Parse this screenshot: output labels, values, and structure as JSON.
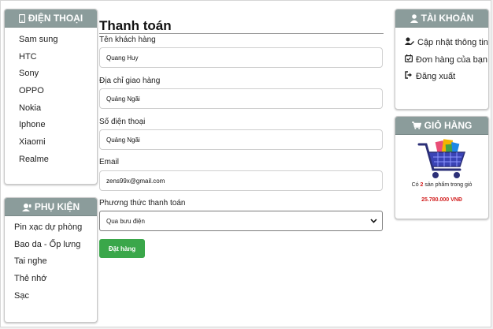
{
  "sidebar_left": {
    "phones": {
      "title": "ĐIỆN THOẠI",
      "icon": "mobile-phone-icon",
      "items": [
        "Sam sung",
        "HTC",
        "Sony",
        "OPPO",
        "Nokia",
        "Iphone",
        "Xiaomi",
        "Realme"
      ]
    },
    "accessories": {
      "title": "PHỤ KIỆN",
      "icon": "headset-user-icon",
      "items": [
        "Pin xạc dự phòng",
        "Bao da - Ốp lưng",
        "Tai nghe",
        "Thẻ nhớ",
        "Sạc"
      ]
    }
  },
  "checkout": {
    "title": "Thanh toán",
    "name_label": "Tên khách hàng",
    "name_value": "Quang Huy",
    "address_label": "Địa chỉ giao hàng",
    "address_value": "Quảng Ngãi",
    "phone_label": "Số điện thoại",
    "phone_value": "Quảng Ngãi",
    "email_label": "Email",
    "email_value": "zens99x@gmail.com",
    "payment_label": "Phương thức thanh toán",
    "payment_selected": "Qua bưu điện",
    "submit_label": "Đặt hàng"
  },
  "sidebar_right": {
    "account": {
      "title": "TÀI KHOẢN",
      "icon": "user-icon",
      "items": [
        {
          "label": "Cập nhật thông tin",
          "icon": "user-edit-icon"
        },
        {
          "label": "Đơn hàng của bạn",
          "icon": "calendar-check-icon"
        },
        {
          "label": "Đăng xuất",
          "icon": "sign-out-icon"
        }
      ]
    },
    "cart": {
      "title": "GIỎ HÀNG",
      "icon": "shopping-cart-icon",
      "text_before": "Có",
      "count": "2",
      "text_after": "sản phẩm trong giỏ",
      "total": "25.780.000 VNĐ"
    }
  },
  "colors": {
    "box_header": "#8b9c9b",
    "button": "#3aa74a",
    "price": "#d21f1f"
  }
}
